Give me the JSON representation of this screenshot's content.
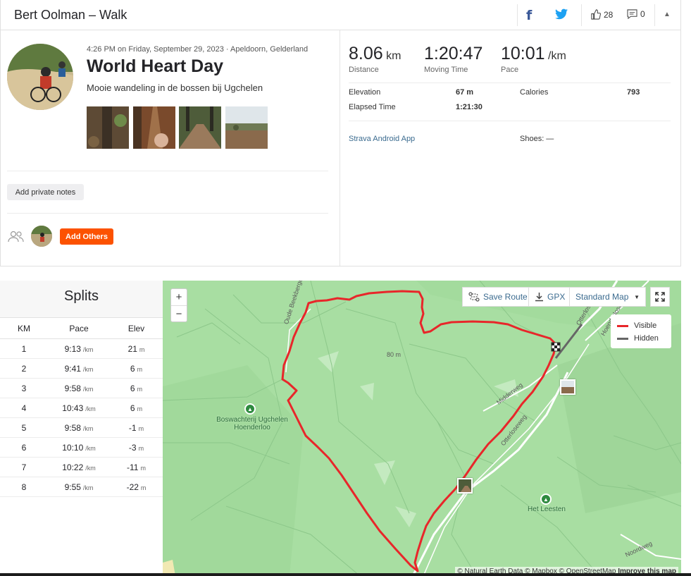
{
  "header": {
    "title": "Bert Oolman – Walk",
    "kudos_count": "28",
    "comment_count": "0"
  },
  "activity": {
    "meta": "4:26 PM on Friday, September 29, 2023 · Apeldoorn, Gelderland",
    "title": "World Heart Day",
    "description": "Mooie wandeling in de bossen bij Ugchelen",
    "add_notes_label": "Add private notes",
    "add_others_label": "Add Others"
  },
  "stats": {
    "distance": {
      "value": "8.06",
      "unit": "km",
      "label": "Distance"
    },
    "moving_time": {
      "value": "1:20:47",
      "label": "Moving Time"
    },
    "pace": {
      "value": "10:01",
      "unit": "/km",
      "label": "Pace"
    },
    "elevation_label": "Elevation",
    "elevation_value": "67 m",
    "calories_label": "Calories",
    "calories_value": "793",
    "elapsed_label": "Elapsed Time",
    "elapsed_value": "1:21:30",
    "device": "Strava Android App",
    "shoes": "Shoes: —"
  },
  "splits": {
    "title": "Splits",
    "headers": [
      "KM",
      "Pace",
      "Elev"
    ],
    "pace_unit": "/km",
    "elev_unit": "m",
    "rows": [
      {
        "km": "1",
        "pace": "9:13",
        "elev": "21"
      },
      {
        "km": "2",
        "pace": "9:41",
        "elev": "6"
      },
      {
        "km": "3",
        "pace": "9:58",
        "elev": "6"
      },
      {
        "km": "4",
        "pace": "10:43",
        "elev": "6"
      },
      {
        "km": "5",
        "pace": "9:58",
        "elev": "-1"
      },
      {
        "km": "6",
        "pace": "10:10",
        "elev": "-3"
      },
      {
        "km": "7",
        "pace": "10:22",
        "elev": "-11"
      },
      {
        "km": "8",
        "pace": "9:55",
        "elev": "-22"
      }
    ]
  },
  "map": {
    "zoom_in": "+",
    "zoom_out": "−",
    "save_route": "Save Route",
    "gpx": "GPX",
    "map_style": "Standard Map",
    "legend_visible": "Visible",
    "legend_hidden": "Hidden",
    "visible_color": "#e8262a",
    "hidden_color": "#666666",
    "attribution_prefix": "© Natural Earth Data © Mapbox © OpenStreetMap",
    "attribution_link": "Improve this map",
    "place_1a": "Boswachterij Ugchelen",
    "place_1b": "Hoenderloo",
    "place_2": "Het Leesten",
    "elev_marker": "80 m",
    "roads": {
      "r1": "Oude Beekbergerweg",
      "r2": "Midderweg",
      "r3": "Otterloseweg",
      "r4": "Otterloseweg",
      "r5": "Hoenderloseweg",
      "r6": "Noordweg"
    }
  }
}
